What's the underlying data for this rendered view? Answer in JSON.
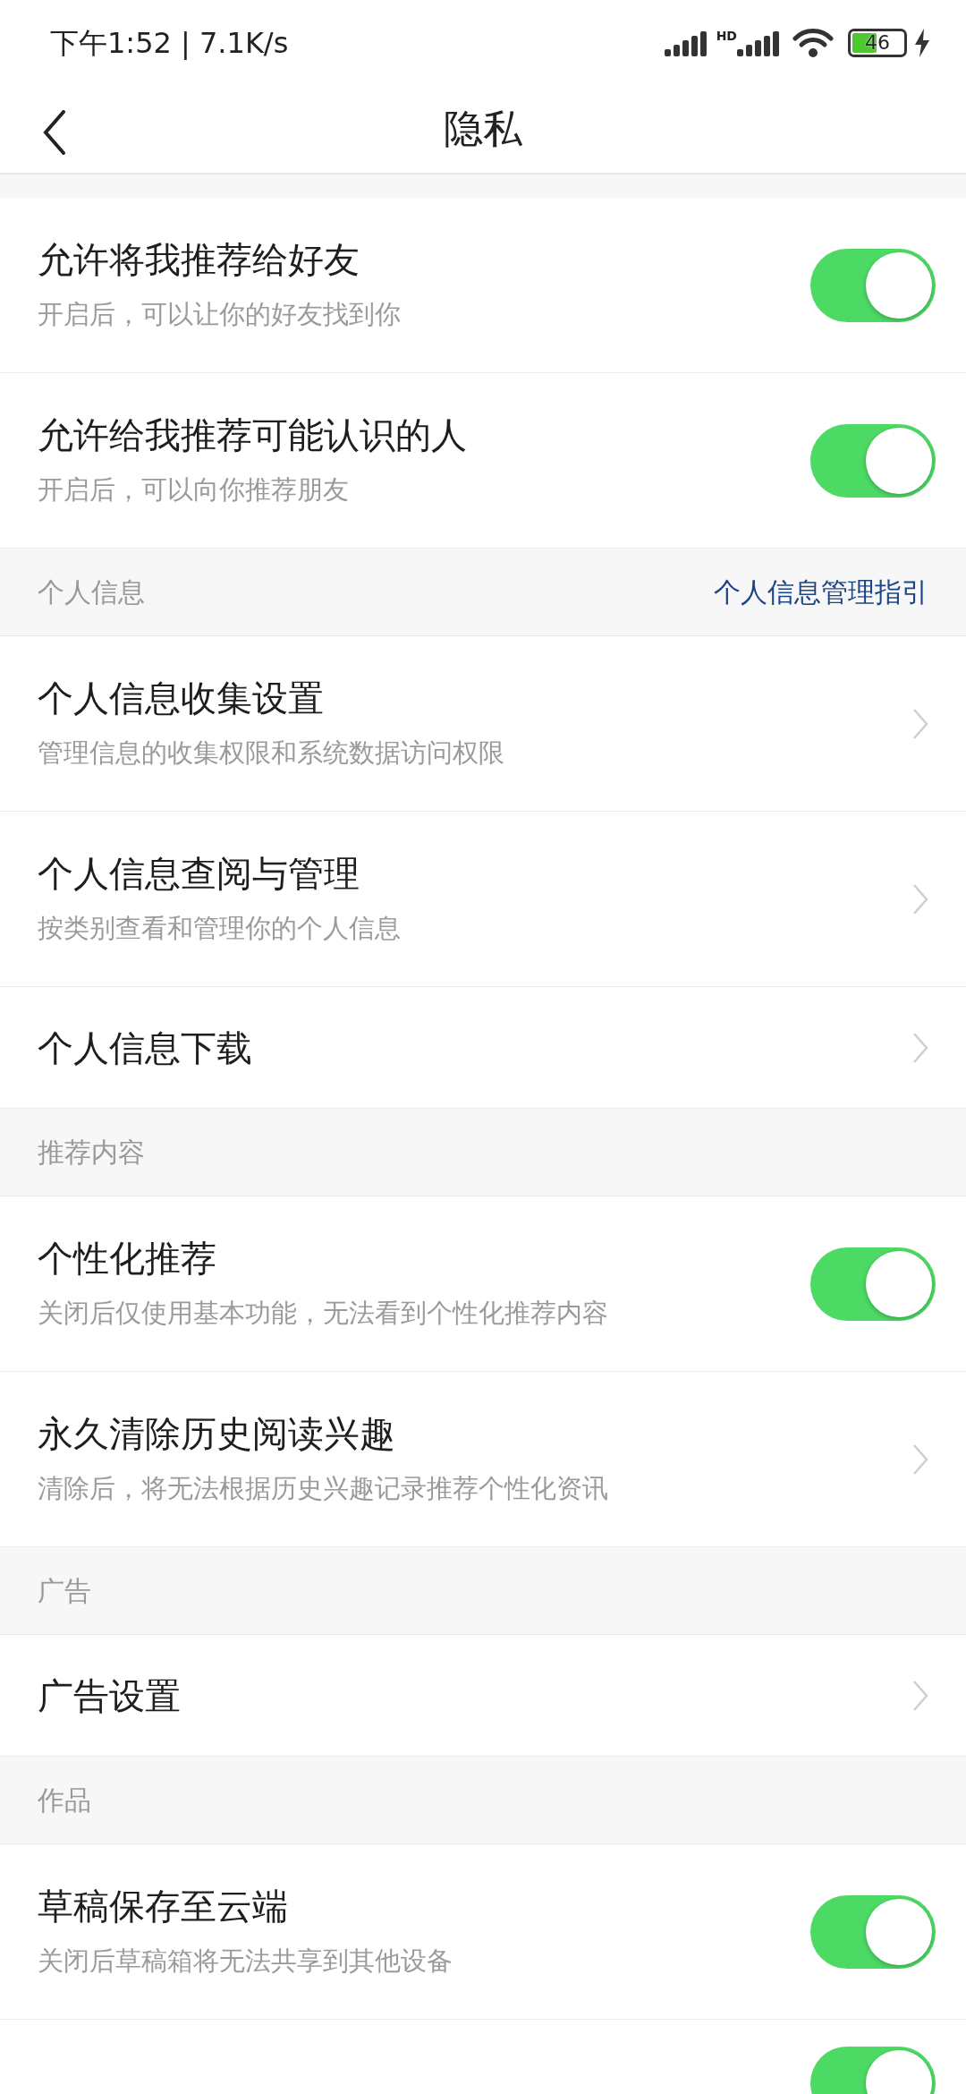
{
  "status_bar": {
    "time": "下午1:52 | 7.1K/s",
    "network_badge": "HD",
    "battery": "46"
  },
  "header": {
    "title": "隐私"
  },
  "sections": [
    {
      "items": [
        {
          "kind": "toggle",
          "title": "允许将我推荐给好友",
          "subtitle": "开启后，可以让你的好友找到你",
          "on": true
        },
        {
          "kind": "toggle",
          "title": "允许给我推荐可能认识的人",
          "subtitle": "开启后，可以向你推荐朋友",
          "on": true
        }
      ]
    },
    {
      "title": "个人信息",
      "link": "个人信息管理指引",
      "items": [
        {
          "kind": "link",
          "title": "个人信息收集设置",
          "subtitle": "管理信息的收集权限和系统数据访问权限"
        },
        {
          "kind": "link",
          "title": "个人信息查阅与管理",
          "subtitle": "按类别查看和管理你的个人信息"
        },
        {
          "kind": "link",
          "title": "个人信息下载"
        }
      ]
    },
    {
      "title": "推荐内容",
      "items": [
        {
          "kind": "toggle",
          "title": "个性化推荐",
          "subtitle": "关闭后仅使用基本功能，无法看到个性化推荐内容",
          "on": true
        },
        {
          "kind": "link",
          "title": "永久清除历史阅读兴趣",
          "subtitle": "清除后，将无法根据历史兴趣记录推荐个性化资讯"
        }
      ]
    },
    {
      "title": "广告",
      "items": [
        {
          "kind": "link",
          "title": "广告设置"
        }
      ]
    },
    {
      "title": "作品",
      "items": [
        {
          "kind": "toggle",
          "title": "草稿保存至云端",
          "subtitle": "关闭后草稿箱将无法共享到其他设备",
          "on": true
        },
        {
          "kind": "toggle",
          "on": true
        }
      ]
    }
  ]
}
